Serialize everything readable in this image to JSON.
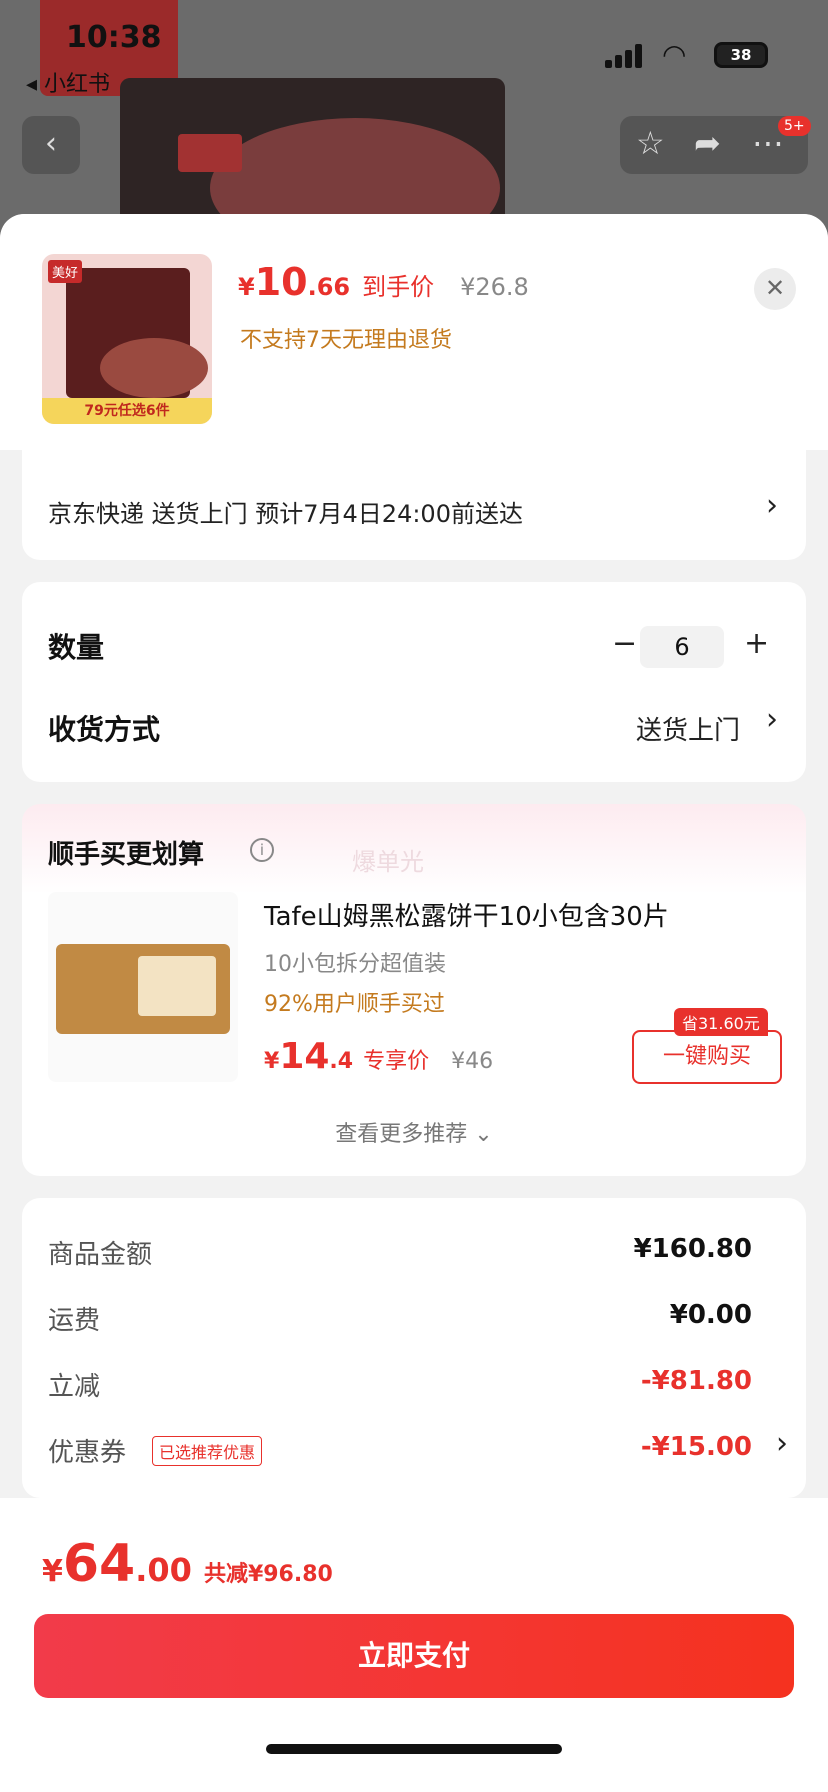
{
  "status": {
    "time": "10:38",
    "back_app": "◂ 小红书",
    "battery": "38"
  },
  "header": {
    "badge": "5+"
  },
  "sheet": {
    "price_currency": "¥",
    "price_int": "10",
    "price_dec": ".66",
    "price_tag": "到手价",
    "price_old": "¥26.8",
    "no_return": "不支持7天无理由退货",
    "thumb_logo": "美好",
    "thumb_promo": "79元任选6件"
  },
  "shipping": {
    "text": "京东快递 送货上门 预计7月4日24:00前送达"
  },
  "quantity": {
    "label": "数量",
    "minus": "−",
    "value": "6",
    "plus": "+"
  },
  "delivery": {
    "label": "收货方式",
    "value": "送货上门"
  },
  "combo": {
    "title": "顺手买更划算",
    "info_icon": "i",
    "watermark": "爆单光",
    "product": {
      "title": "Tafe山姆黑松露饼干10小包含30片",
      "subtitle": "10小包拆分超值装",
      "percent": "92%用户顺手买过",
      "price_currency": "¥",
      "price_int": "14",
      "price_dec": ".4",
      "price_tag": "专享价",
      "price_old": "¥46",
      "save_tag": "省31.60元",
      "buy_label": "一键购买"
    },
    "more": "查看更多推荐 ⌄"
  },
  "summary": {
    "rows": [
      {
        "label": "商品金额",
        "value": "¥160.80"
      },
      {
        "label": "运费",
        "value": "¥0.00"
      },
      {
        "label": "立减",
        "value": "-¥81.80"
      },
      {
        "label": "优惠券",
        "value": "-¥15.00",
        "tag": "已选推荐优惠"
      }
    ]
  },
  "footer": {
    "total_currency": "¥",
    "total_int": "64",
    "total_dec": ".00",
    "reduction": "共减¥96.80",
    "pay_label": "立即支付"
  },
  "colors": {
    "accent": "#e8312c",
    "warning": "#c47a1e"
  }
}
